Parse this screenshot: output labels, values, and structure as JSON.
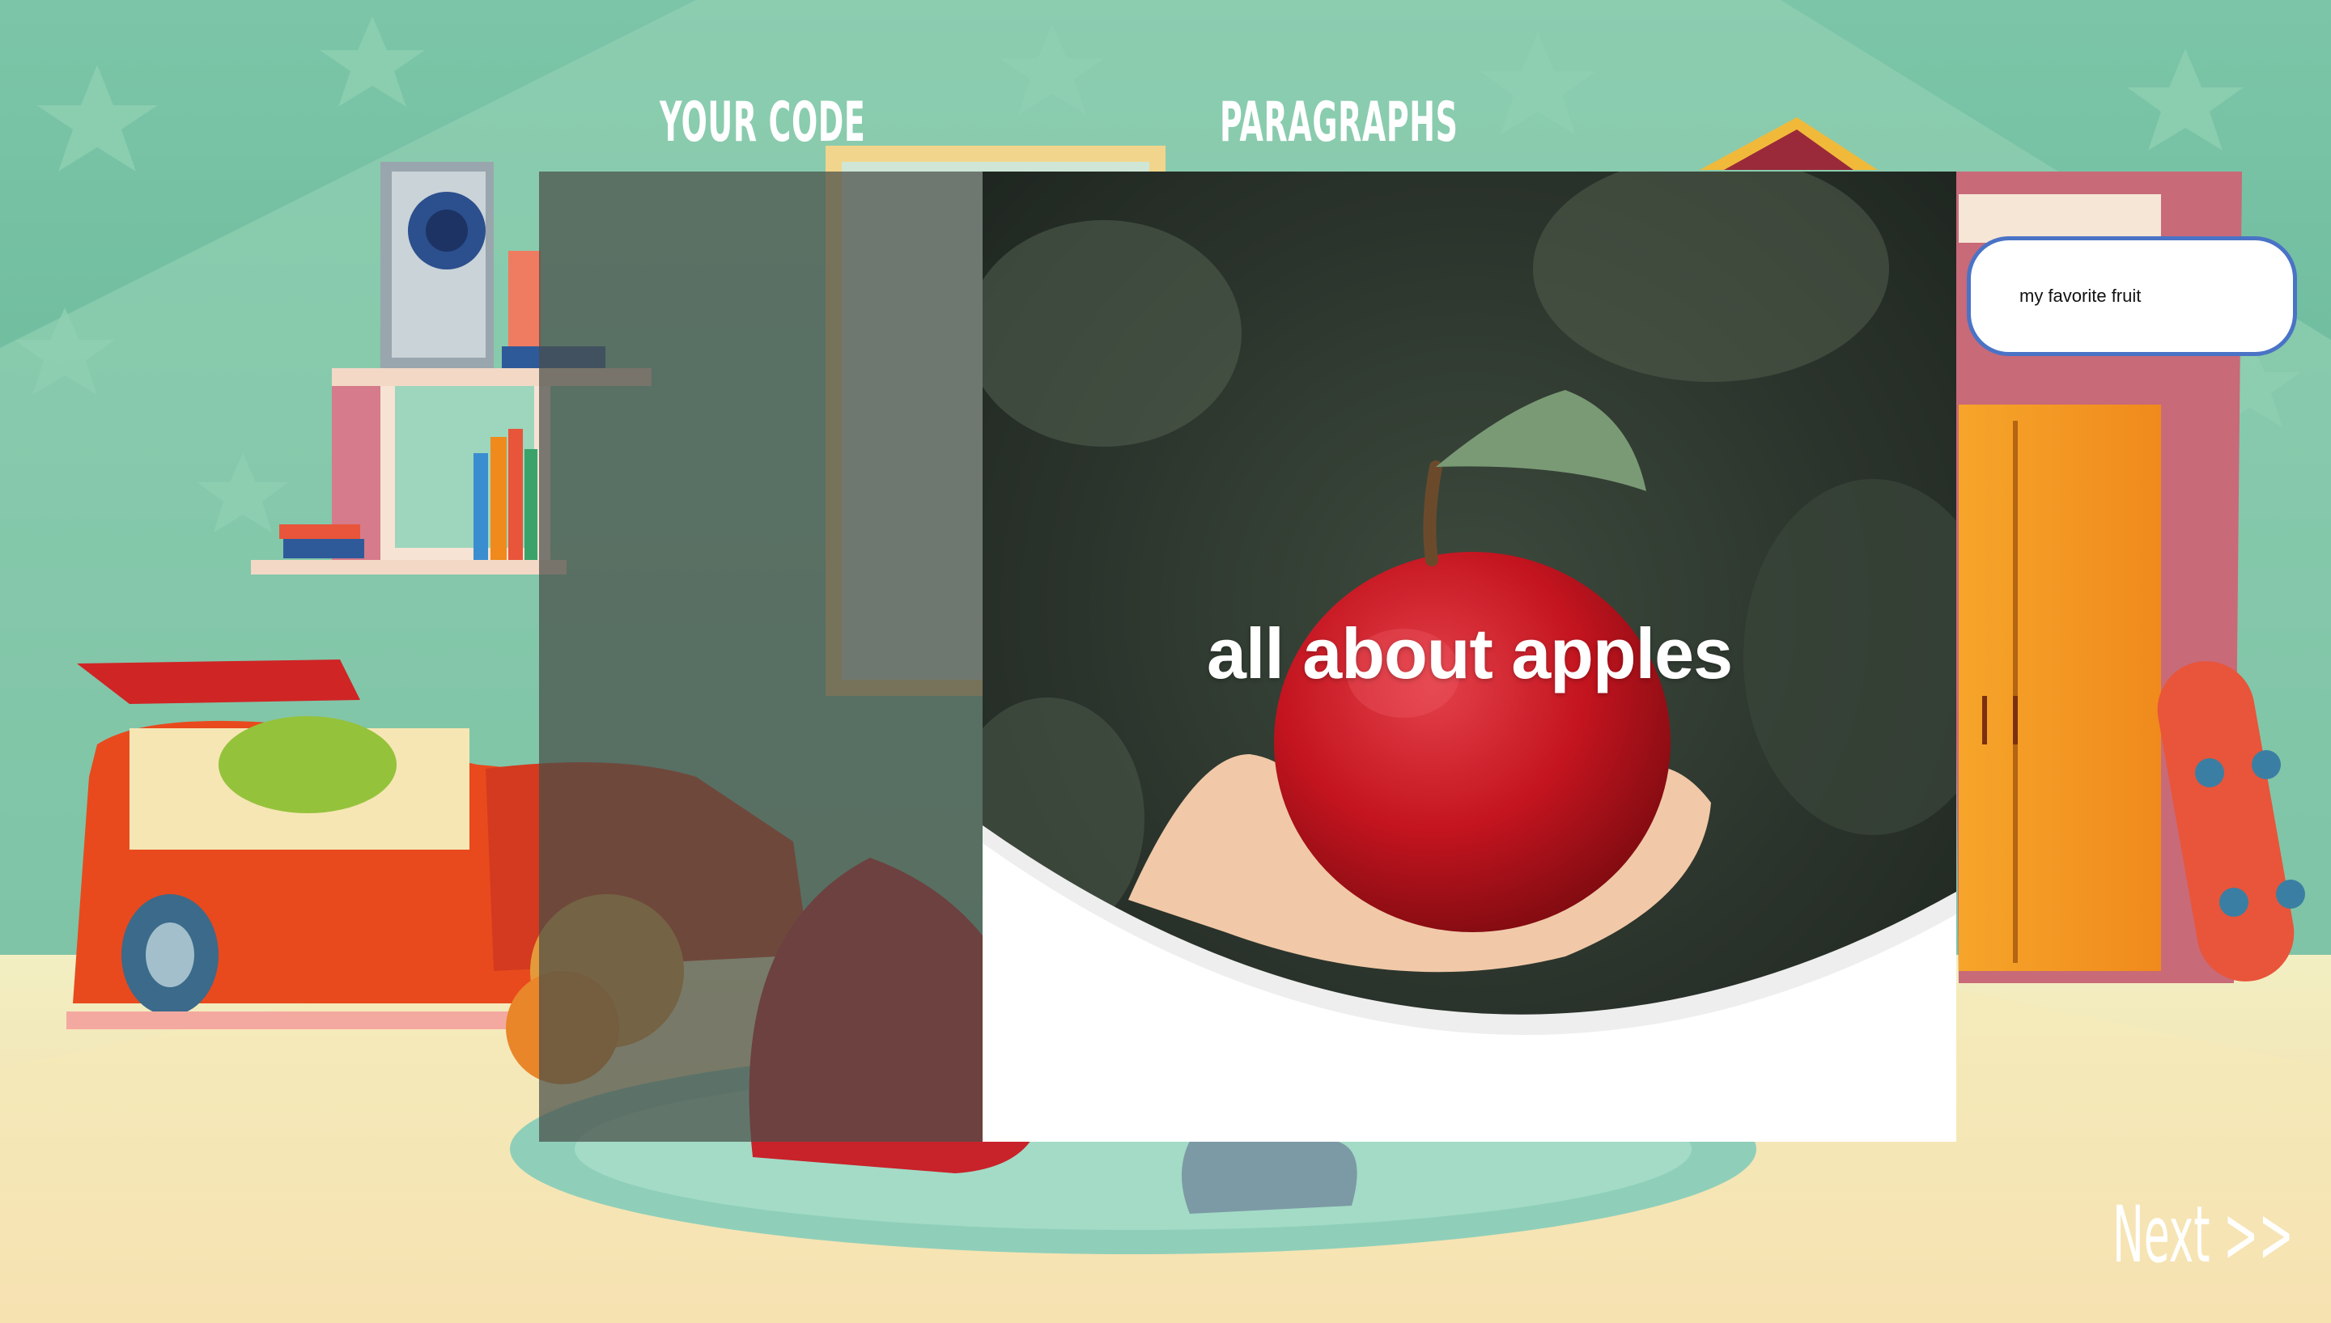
{
  "tabs": [
    {
      "label": "YOUR CODE"
    },
    {
      "label": "PARAGRAPHS"
    }
  ],
  "preview": {
    "title": "all about apples"
  },
  "answer_bubble": {
    "text": "my favorite fruit"
  },
  "navigation": {
    "next_label": "Next >>"
  }
}
